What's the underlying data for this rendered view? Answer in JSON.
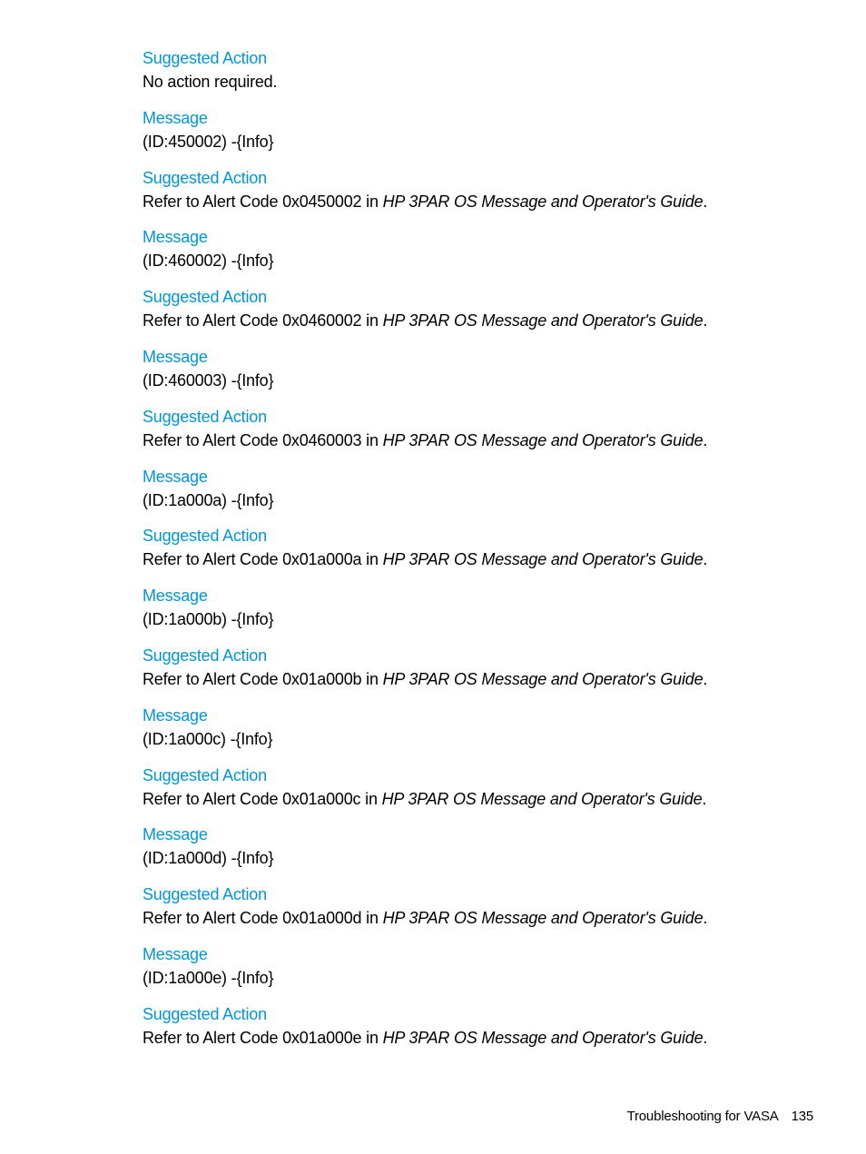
{
  "entries": [
    {
      "heading": "Suggested Action",
      "text": "No action required.",
      "type": "plain"
    },
    {
      "heading": "Message",
      "text": "(ID:450002) -{Info}",
      "type": "plain"
    },
    {
      "heading": "Suggested Action",
      "prefix": "Refer to Alert Code 0x0450002 in ",
      "guide": "HP 3PAR OS Message and Operator's Guide",
      "suffix": ".",
      "type": "ref"
    },
    {
      "heading": "Message",
      "text": "(ID:460002) -{Info}",
      "type": "plain"
    },
    {
      "heading": "Suggested Action",
      "prefix": "Refer to Alert Code 0x0460002 in ",
      "guide": "HP 3PAR OS Message and Operator's Guide",
      "suffix": ".",
      "type": "ref"
    },
    {
      "heading": "Message",
      "text": "(ID:460003) -{Info}",
      "type": "plain"
    },
    {
      "heading": "Suggested Action",
      "prefix": "Refer to Alert Code 0x0460003 in ",
      "guide": "HP 3PAR OS Message and Operator's Guide",
      "suffix": ".",
      "type": "ref"
    },
    {
      "heading": "Message",
      "text": "(ID:1a000a) -{Info}",
      "type": "plain"
    },
    {
      "heading": "Suggested Action",
      "prefix": "Refer to Alert Code 0x01a000a in ",
      "guide": "HP 3PAR OS Message and Operator's Guide",
      "suffix": ".",
      "type": "ref"
    },
    {
      "heading": "Message",
      "text": "(ID:1a000b) -{Info}",
      "type": "plain"
    },
    {
      "heading": "Suggested Action",
      "prefix": "Refer to Alert Code 0x01a000b in ",
      "guide": "HP 3PAR OS Message and Operator's Guide",
      "suffix": ".",
      "type": "ref"
    },
    {
      "heading": "Message",
      "text": "(ID:1a000c) -{Info}",
      "type": "plain"
    },
    {
      "heading": "Suggested Action",
      "prefix": "Refer to Alert Code 0x01a000c in ",
      "guide": "HP 3PAR OS Message and Operator's Guide",
      "suffix": ".",
      "type": "ref"
    },
    {
      "heading": "Message",
      "text": "(ID:1a000d) -{Info}",
      "type": "plain"
    },
    {
      "heading": "Suggested Action",
      "prefix": "Refer to Alert Code 0x01a000d in ",
      "guide": "HP 3PAR OS Message and Operator's Guide",
      "suffix": ".",
      "type": "ref"
    },
    {
      "heading": "Message",
      "text": "(ID:1a000e) -{Info}",
      "type": "plain"
    },
    {
      "heading": "Suggested Action",
      "prefix": "Refer to Alert Code 0x01a000e in ",
      "guide": "HP 3PAR OS Message and Operator's Guide",
      "suffix": ".",
      "type": "ref"
    }
  ],
  "footer": {
    "section": "Troubleshooting for VASA",
    "page": "135"
  },
  "colors": {
    "heading": "#0096d6",
    "text": "#000000"
  }
}
